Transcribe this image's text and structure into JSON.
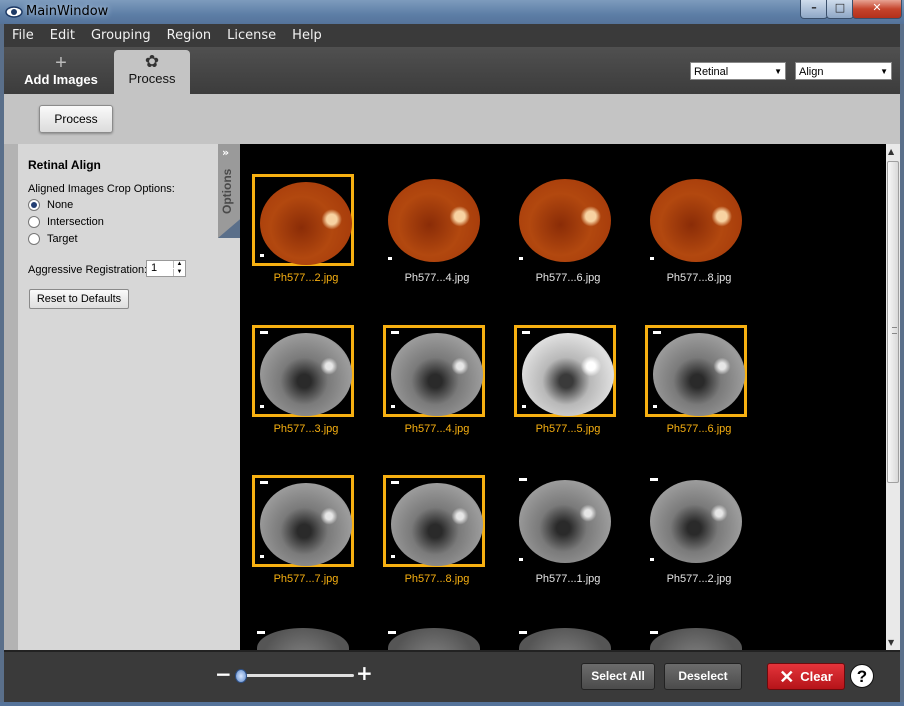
{
  "window": {
    "title": "MainWindow",
    "min": "–",
    "max": "□",
    "close": "✕"
  },
  "menu": [
    "File",
    "Edit",
    "Grouping",
    "Region",
    "License",
    "Help"
  ],
  "tabs": {
    "add": {
      "icon": "+",
      "label": "Add Images"
    },
    "process": {
      "icon": "✿",
      "label": "Process"
    }
  },
  "selects": {
    "mode": "Retinal",
    "operation": "Align",
    "arrow": "▼"
  },
  "toolbar": {
    "process_label": "Process"
  },
  "options": {
    "tab_label": "Options",
    "collapse": "»",
    "title": "Retinal Align",
    "crop_label": "Aligned Images Crop Options:",
    "crop_choices": [
      "None",
      "Intersection",
      "Target"
    ],
    "crop_selected": "None",
    "aggressive_label": "Aggressive Registration:",
    "aggressive_value": "1",
    "reset_label": "Reset to Defaults"
  },
  "gallery": {
    "thumbnails": [
      {
        "label": "Ph577...2.jpg",
        "selected": true,
        "style": "color"
      },
      {
        "label": "Ph577...4.jpg",
        "selected": false,
        "style": "color"
      },
      {
        "label": "Ph577...6.jpg",
        "selected": false,
        "style": "color"
      },
      {
        "label": "Ph577...8.jpg",
        "selected": false,
        "style": "color"
      },
      {
        "label": "Ph577...3.jpg",
        "selected": true,
        "style": "gray"
      },
      {
        "label": "Ph577...4.jpg",
        "selected": true,
        "style": "gray"
      },
      {
        "label": "Ph577...5.jpg",
        "selected": true,
        "style": "bright"
      },
      {
        "label": "Ph577...6.jpg",
        "selected": true,
        "style": "gray"
      },
      {
        "label": "Ph577...7.jpg",
        "selected": true,
        "style": "gray"
      },
      {
        "label": "Ph577...8.jpg",
        "selected": true,
        "style": "gray"
      },
      {
        "label": "Ph577...1.jpg",
        "selected": false,
        "style": "gray"
      },
      {
        "label": "Ph577...2.jpg",
        "selected": false,
        "style": "gray"
      }
    ]
  },
  "bottom": {
    "zoom_minus": "−",
    "zoom_plus": "+",
    "select_all": "Select All",
    "deselect": "Deselect",
    "clear_icon": "✕",
    "clear": "Clear",
    "help": "?"
  },
  "colors": {
    "selection": "#f7b011",
    "clear": "#d3252b",
    "panel": "#d7d7d7",
    "bar": "#3a3a3a"
  }
}
